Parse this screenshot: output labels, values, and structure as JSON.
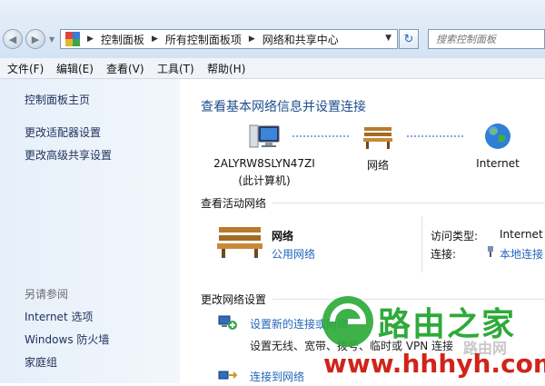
{
  "address_bar": {
    "breadcrumbs": [
      "控制面板",
      "所有控制面板项",
      "网络和共享中心"
    ]
  },
  "search": {
    "placeholder": "搜索控制面板"
  },
  "menu": {
    "items": [
      "文件(F)",
      "编辑(E)",
      "查看(V)",
      "工具(T)",
      "帮助(H)"
    ]
  },
  "sidebar": {
    "links": [
      "控制面板主页",
      "更改适配器设置",
      "更改高级共享设置"
    ],
    "see_also_title": "另请参阅",
    "see_also": [
      "Internet 选项",
      "Windows 防火墙",
      "家庭组"
    ]
  },
  "main": {
    "title": "查看基本网络信息并设置连接",
    "map": {
      "computer_name": "2ALYRW8SLYN47ZI",
      "computer_sub": "(此计算机)",
      "network": "网络",
      "internet": "Internet"
    },
    "active_header": "查看活动网络",
    "active": {
      "name": "网络",
      "type_link": "公用网络",
      "access_label": "访问类型:",
      "access_value": "Internet",
      "conn_label": "连接:",
      "conn_value": "本地连接"
    },
    "change_header": "更改网络设置",
    "settings": [
      {
        "link": "设置新的连接或网络",
        "desc": "设置无线、宽带、拨号、临时或 VPN 连接"
      },
      {
        "link": "连接到网络",
        "desc": ""
      }
    ]
  },
  "watermark": {
    "brand": "路由之家",
    "site_cn": "路由网",
    "url": "www.hhhyh.com",
    "colors": {
      "green": "#2eaa3a",
      "red": "#d0241b"
    }
  }
}
